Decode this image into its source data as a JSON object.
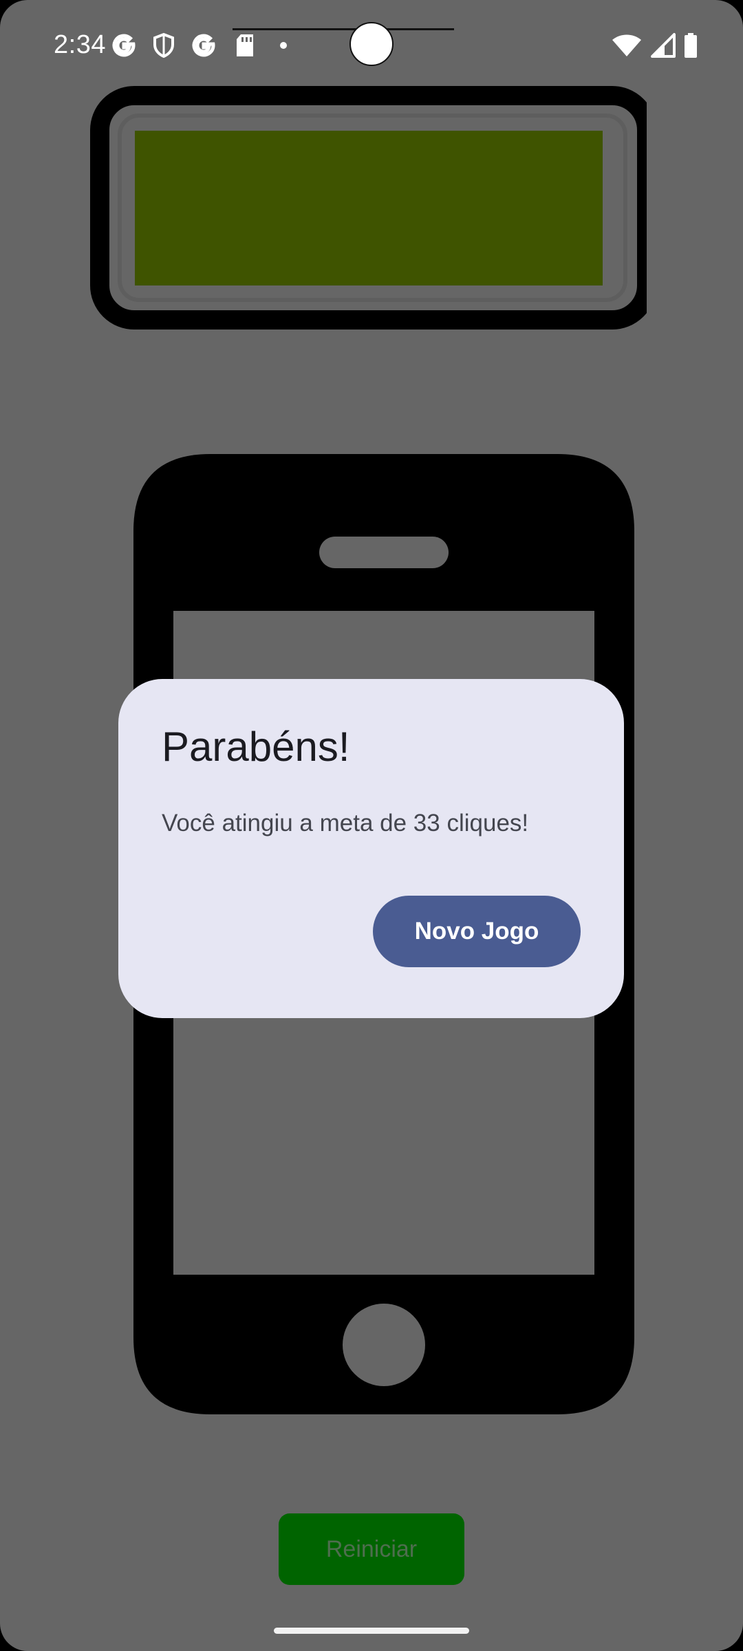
{
  "status_bar": {
    "time": "2:34",
    "left_icons": [
      "google-icon",
      "shield-icon",
      "google-icon",
      "sd-card-icon",
      "dot-icon"
    ],
    "right_icons": [
      "wifi-icon",
      "signal-icon",
      "battery-icon"
    ]
  },
  "illustrations": {
    "battery_fill_color": "#3f5400",
    "phone_color": "#000000"
  },
  "main": {
    "restart_label": "Reiniciar"
  },
  "dialog": {
    "title": "Parabéns!",
    "message": "Você atingiu a meta de 33 cliques!",
    "button_label": "Novo Jogo"
  },
  "colors": {
    "scrim": "#666666",
    "dialog_bg": "#e6e6f3",
    "button_bg": "#4a5c92",
    "restart_bg": "#006400"
  }
}
